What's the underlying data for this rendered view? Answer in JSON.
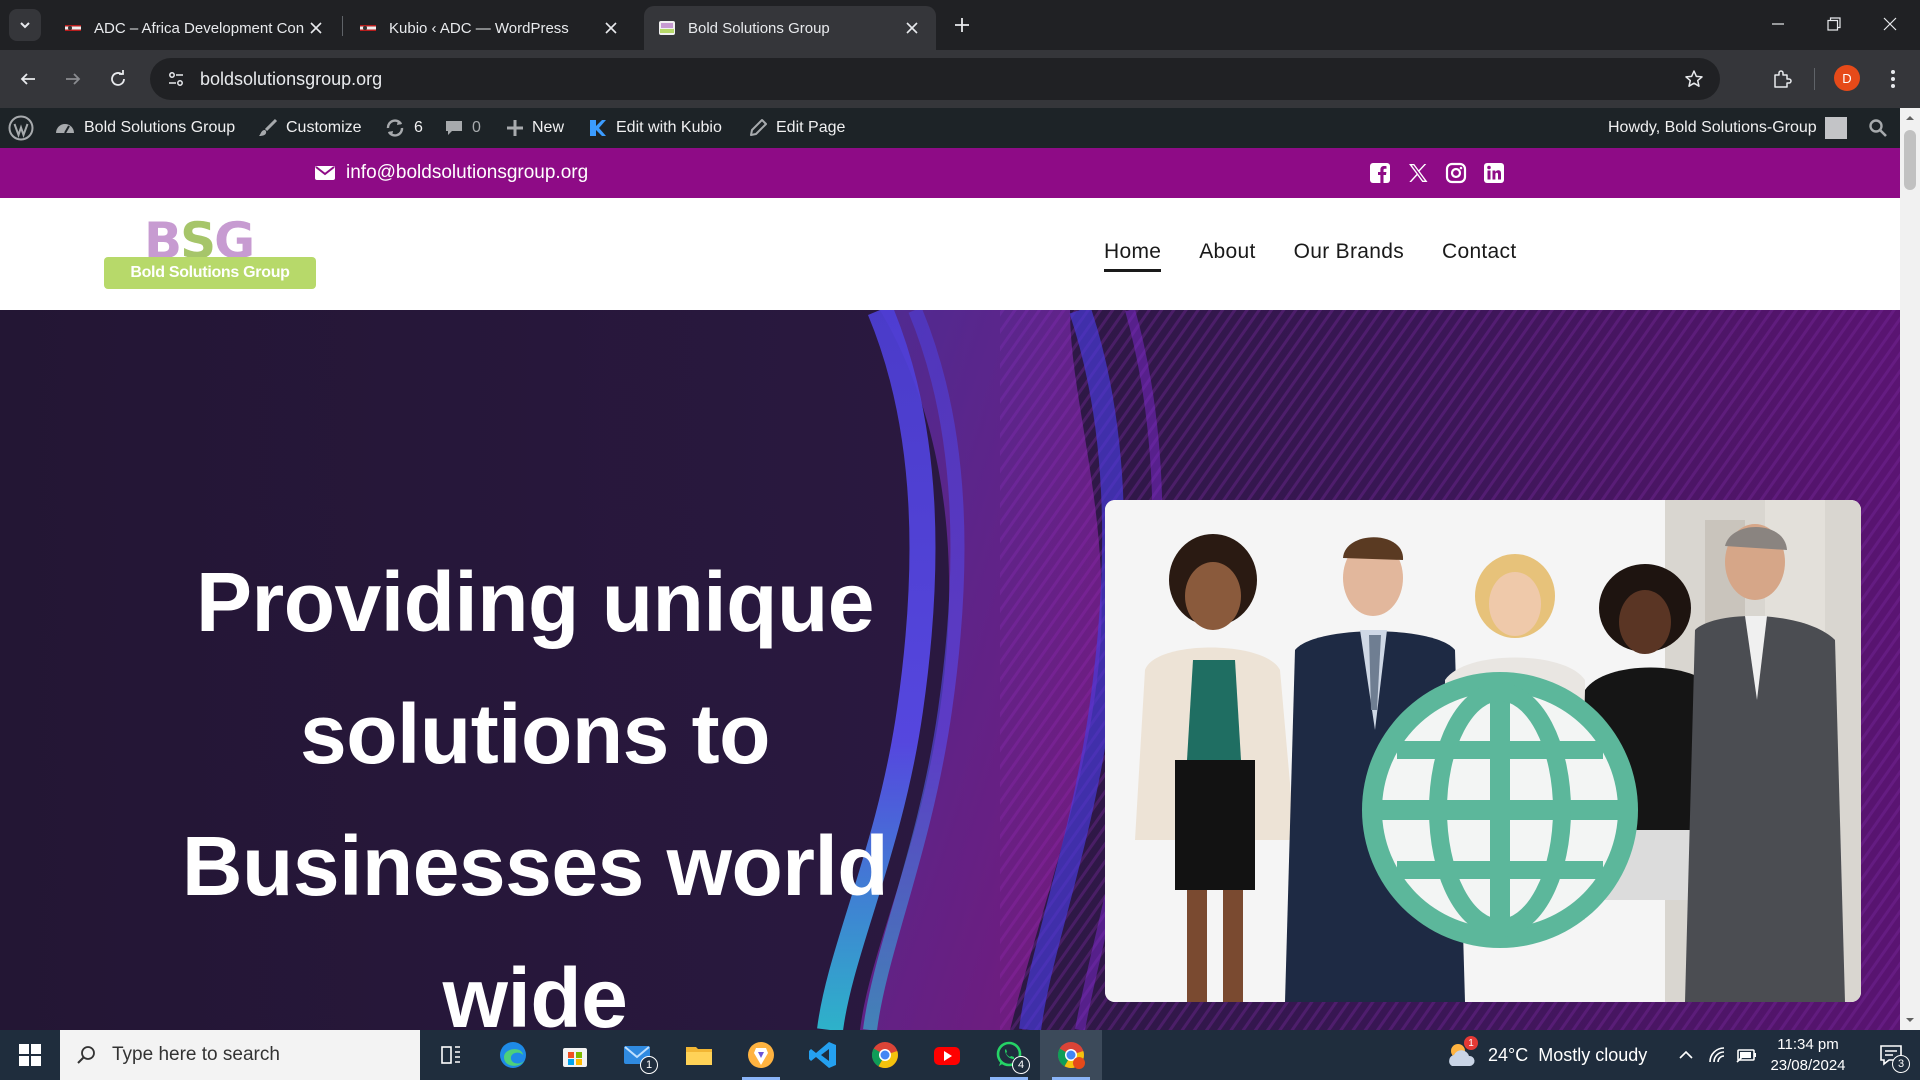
{
  "browser": {
    "tabs": [
      {
        "title": "ADC – Africa Development Con",
        "active": false
      },
      {
        "title": "Kubio ‹ ADC — WordPress",
        "active": false
      },
      {
        "title": "Bold Solutions Group",
        "active": true
      }
    ],
    "url": "boldsolutionsgroup.org",
    "profile_initial": "D"
  },
  "wp_admin_bar": {
    "site_name": "Bold Solutions Group",
    "customize": "Customize",
    "updates_count": "6",
    "comments_count": "0",
    "new": "New",
    "edit_with_kubio": "Edit with Kubio",
    "edit_page": "Edit Page",
    "howdy": "Howdy, Bold Solutions-Group"
  },
  "site": {
    "topbar": {
      "email": "info@boldsolutionsgroup.org",
      "social_icons": [
        "facebook-icon",
        "x-icon",
        "instagram-icon",
        "linkedin-icon"
      ],
      "background_color": "#8e0b86"
    },
    "logo": {
      "letters": {
        "b": "B",
        "s": "S",
        "g": "G"
      },
      "tagline": "Bold Solutions Group"
    },
    "nav": {
      "items": [
        {
          "label": "Home",
          "current": true
        },
        {
          "label": "About",
          "current": false
        },
        {
          "label": "Our Brands",
          "current": false
        },
        {
          "label": "Contact",
          "current": false
        }
      ]
    },
    "hero": {
      "title": "Providing unique solutions to Businesses world wide",
      "image_alt": "business people holding a globe"
    }
  },
  "taskbar": {
    "search_placeholder": "Type here to search",
    "mail_badge": "1",
    "whatsapp_badge": "4",
    "weather_temp": "24°C",
    "weather_text": "Mostly cloudy",
    "weather_alert": "1",
    "time": "11:34 pm",
    "date": "23/08/2024",
    "notifications_count": "3"
  }
}
